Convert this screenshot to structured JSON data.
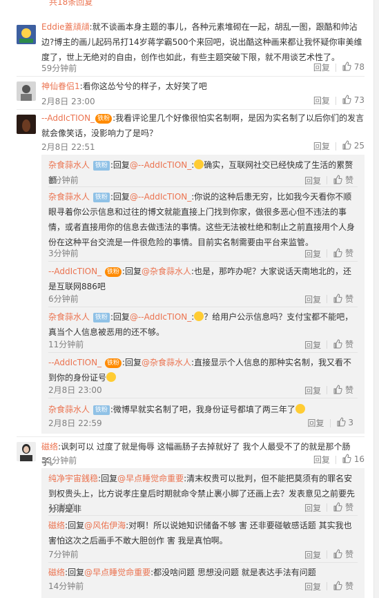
{
  "top_link": "共18条回复",
  "labels": {
    "reply": "回复",
    "like_word": "赞",
    "reply_prefix": "回复",
    "colon": ":"
  },
  "comments": [
    {
      "user": "Eddie蓋頏頏",
      "text": "就不谈画本身主题的事儿，各种元素堆砌在一起，胡乱一图，跟酷和帅沾边?博主的画儿起码吊打14岁蒋学霸500个来回吧，说出酷这种画来都让我怀疑你审美维度了，世上无绝对的自由，创作也如此，有些主题突破下限，就不用谈艺术性了。",
      "time": "59分钟前",
      "likes": "78"
    },
    {
      "user": "神仙眷侣1",
      "text": "看你这怂兮兮的样子，太好笑了吧",
      "time": "2月8日 23:00",
      "likes": "73"
    },
    {
      "user": "--AddIcTION_",
      "badge": "铁粉",
      "text": "我看评论里几个好像很怕实名制啊，是因为实名制了以后你们的发言就会像笑话，没影响力了是吗？",
      "time": "2月8日 22:51",
      "likes": "25"
    },
    {
      "user": "磁络",
      "text": "讽刺可以 过度了就是侮辱 这幅画肠子去掉就好了 我个人最受不了的就是那个肠子。",
      "time": "53分钟前",
      "likes": "16"
    }
  ],
  "replies_a": [
    {
      "user": "杂食蒜水人",
      "badge": "铁粉",
      "target": "@--AddIcTION_",
      "text": "确实，互联网社交已经快成了生活的累赘额",
      "time": "2分钟前",
      "likes": ""
    },
    {
      "user": "杂食蒜水人",
      "badge": "铁粉",
      "target": "@--AddIcTION_",
      "text": "你说的这种后患无穷，比如我今天看你不顺眼寻着你公示信息和过往的博文就能直接上门找到你家，做很多恶心但不违法的事情，或者直接用你的信息去做违法的事情。这些无法被杜绝和制止之前直接用个人身份在这种平台交流是一件很危险的事情。目前实名制需要由平台来监管。",
      "time": "3分钟前",
      "likes": ""
    },
    {
      "user": "--AddIcTION_",
      "badge": "铁粉",
      "target": "@杂食蒜水人",
      "text": "也是，那咋办呢？大家说话天南地北的，还是互联网886吧",
      "time": "6分钟前",
      "likes": ""
    },
    {
      "user": "杂食蒜水人",
      "badge": "铁粉",
      "target": "@--AddIcTION_",
      "text": "？给用户公示信息吗？支付宝都不能吧，真当个人信息被恶用的还不够。",
      "time": "11分钟前",
      "likes": ""
    },
    {
      "user": "--AddIcTION_",
      "badge": "铁粉",
      "target": "@杂食蒜水人",
      "text": "直接显示个人信息的那种实名制，我又看不到你的身份证号",
      "time": "2月8日 23:00",
      "likes": ""
    },
    {
      "user": "杂食蒜水人",
      "badge": "铁粉",
      "target": "",
      "text": "微博早就实名制了吧，我身份证号都填了两三年了",
      "time": "2月8日 22:59",
      "likes": "3"
    }
  ],
  "replies_b": [
    {
      "user": "纯净宇宙銭稳",
      "target": "@早点睡觉命重要",
      "text": "清末权贵可以批判，但不能把莫须有的罪名安到权贵头上，比方说孝庄皇后时期就命令禁止裹小脚了还画上去？发表意见之前要先分清是非",
      "time": "10秒前",
      "likes": ""
    },
    {
      "user": "磁络",
      "target": "@风佑伊海",
      "text": "对啊！所以说她知识储备不够 害 还非要碰敏感话题 其实我也害怕这次之后画手不敢大胆创作 害 我是真怕啊。",
      "time": "7分钟前",
      "likes": ""
    },
    {
      "user": "磁络",
      "target": "@早点睡觉命重要",
      "text": "都没啥问题 思想没问题 就是表达手法有问题",
      "time": "14分钟前",
      "likes": ""
    }
  ],
  "colors": {
    "accent": "#eb7350",
    "meta": "#808080",
    "reply_bg": "#f2f2f2"
  },
  "icons": [
    "thumb-up-icon",
    "like-icon",
    "smile-emoji-icon",
    "fan-badge-icon"
  ]
}
